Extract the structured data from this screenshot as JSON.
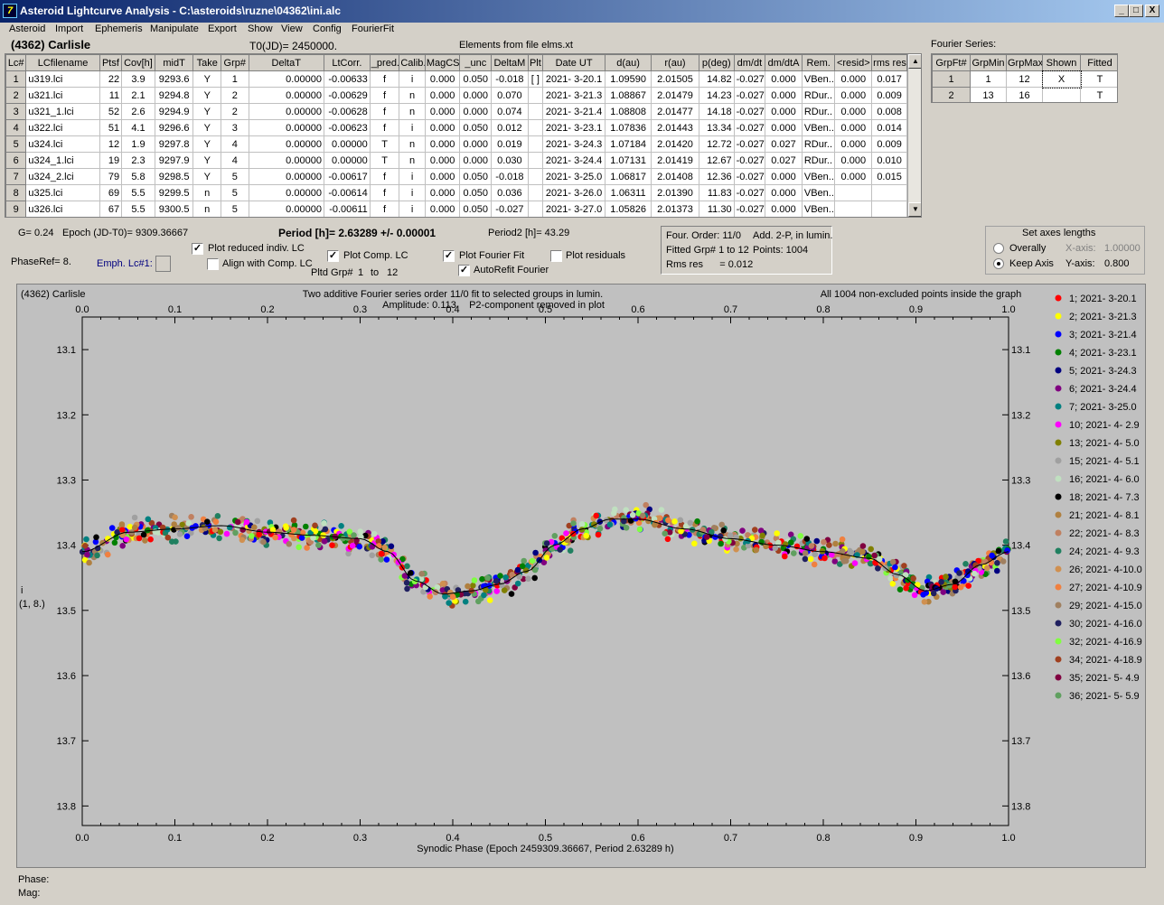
{
  "window": {
    "title": "Asteroid Lightcurve Analysis - C:\\asteroids\\ruzne\\04362\\ini.alc",
    "app_icon": "7",
    "min": "_",
    "max": "□",
    "close": "X"
  },
  "menu": [
    "Asteroid",
    "Import",
    "Ephemeris",
    "Manipulate",
    "Export",
    "Show",
    "View",
    "Config",
    "FourierFit"
  ],
  "header": {
    "object": "(4362) Carlisle",
    "t0": "T0(JD)= 2450000.",
    "elements": "Elements from file elms.xt",
    "fourier_series": "Fourier Series:"
  },
  "lc_table": {
    "columns": [
      "Lc#",
      "LCfilename",
      "Ptsf",
      "Cov[h]",
      "midT",
      "Take",
      "Grp#",
      "DeltaT",
      "LtCorr.",
      "_pred.",
      "Calib.",
      "MagCS",
      "_unc",
      "DeltaM",
      "Plt",
      "Date UT",
      "d(au)",
      "r(au)",
      "p(deg)",
      "dm/dt",
      "dm/dtA",
      "Rem.",
      "<resid>",
      "rms res"
    ],
    "rows": [
      [
        "1",
        "u319.lci",
        "22",
        "3.9",
        "9293.6",
        "Y",
        "1",
        "0.00000",
        "-0.00633",
        "f",
        "i",
        "0.000",
        "0.050",
        "-0.018",
        "[ ]",
        "2021- 3-20.1",
        "1.09590",
        "2.01505",
        "14.82",
        "-0.027",
        "0.000",
        "VBen..",
        "0.000",
        "0.017"
      ],
      [
        "2",
        "u321.lci",
        "11",
        "2.1",
        "9294.8",
        "Y",
        "2",
        "0.00000",
        "-0.00629",
        "f",
        "n",
        "0.000",
        "0.000",
        "0.070",
        "",
        "2021- 3-21.3",
        "1.08867",
        "2.01479",
        "14.23",
        "-0.027",
        "0.000",
        "RDur..",
        "0.000",
        "0.009"
      ],
      [
        "3",
        "u321_1.lci",
        "52",
        "2.6",
        "9294.9",
        "Y",
        "2",
        "0.00000",
        "-0.00628",
        "f",
        "n",
        "0.000",
        "0.000",
        "0.074",
        "",
        "2021- 3-21.4",
        "1.08808",
        "2.01477",
        "14.18",
        "-0.027",
        "0.000",
        "RDur..",
        "0.000",
        "0.008"
      ],
      [
        "4",
        "u322.lci",
        "51",
        "4.1",
        "9296.6",
        "Y",
        "3",
        "0.00000",
        "-0.00623",
        "f",
        "i",
        "0.000",
        "0.050",
        "0.012",
        "",
        "2021- 3-23.1",
        "1.07836",
        "2.01443",
        "13.34",
        "-0.027",
        "0.000",
        "VBen..",
        "0.000",
        "0.014"
      ],
      [
        "5",
        "u324.lci",
        "12",
        "1.9",
        "9297.8",
        "Y",
        "4",
        "0.00000",
        "0.00000",
        "T",
        "n",
        "0.000",
        "0.000",
        "0.019",
        "",
        "2021- 3-24.3",
        "1.07184",
        "2.01420",
        "12.72",
        "-0.027",
        "0.027",
        "RDur..",
        "0.000",
        "0.009"
      ],
      [
        "6",
        "u324_1.lci",
        "19",
        "2.3",
        "9297.9",
        "Y",
        "4",
        "0.00000",
        "0.00000",
        "T",
        "n",
        "0.000",
        "0.000",
        "0.030",
        "",
        "2021- 3-24.4",
        "1.07131",
        "2.01419",
        "12.67",
        "-0.027",
        "0.027",
        "RDur..",
        "0.000",
        "0.010"
      ],
      [
        "7",
        "u324_2.lci",
        "79",
        "5.8",
        "9298.5",
        "Y",
        "5",
        "0.00000",
        "-0.00617",
        "f",
        "i",
        "0.000",
        "0.050",
        "-0.018",
        "",
        "2021- 3-25.0",
        "1.06817",
        "2.01408",
        "12.36",
        "-0.027",
        "0.000",
        "VBen..",
        "0.000",
        "0.015"
      ],
      [
        "8",
        "u325.lci",
        "69",
        "5.5",
        "9299.5",
        "n",
        "5",
        "0.00000",
        "-0.00614",
        "f",
        "i",
        "0.000",
        "0.050",
        "0.036",
        "",
        "2021- 3-26.0",
        "1.06311",
        "2.01390",
        "11.83",
        "-0.027",
        "0.000",
        "VBen..",
        "",
        ""
      ],
      [
        "9",
        "u326.lci",
        "67",
        "5.5",
        "9300.5",
        "n",
        "5",
        "0.00000",
        "-0.00611",
        "f",
        "i",
        "0.000",
        "0.050",
        "-0.027",
        "",
        "2021- 3-27.0",
        "1.05826",
        "2.01373",
        "11.30",
        "-0.027",
        "0.000",
        "VBen..",
        "",
        ""
      ]
    ]
  },
  "fourier_table": {
    "columns": [
      "GrpFt#",
      "GrpMin",
      "GrpMax",
      "Shown",
      "Fitted"
    ],
    "rows": [
      [
        "1",
        "1",
        "12",
        "X",
        "T"
      ],
      [
        "2",
        "13",
        "16",
        "",
        "T"
      ]
    ]
  },
  "controls": {
    "g": "G= 0.24",
    "epoch": "Epoch (JD-T0)= 9309.36667",
    "period": "Period [h]= 2.63289 +/- 0.00001",
    "period2": "Period2 [h]= 43.29",
    "phaseref": "PhaseRef= 8.",
    "emph": "Emph. Lc#1:",
    "plot_reduced": "Plot reduced indiv. LC",
    "align": "Align with Comp. LC",
    "plot_comp": "Plot Comp. LC",
    "pltd_grp": "Pltd Grp#",
    "grp_from": "1",
    "to": "to",
    "grp_to": "12",
    "plot_fourier": "Plot Fourier Fit",
    "autorefit": "AutoRefit Fourier",
    "plot_resid": "Plot residuals",
    "check": "✓"
  },
  "fit_info": {
    "order": "Four. Order: 11/0",
    "add": "Add. 2-P, in lumin.",
    "fitted": "Fitted Grp# 1 to 12",
    "points": "Points: 1004",
    "rms": "Rms res      = 0.012"
  },
  "axes_box": {
    "title": "Set axes lengths",
    "overally": "Overally",
    "keep": "Keep Axis",
    "xaxis_label": "X-axis:",
    "xaxis_val": "1.00000",
    "yaxis_label": "Y-axis:",
    "yaxis_val": "0.800"
  },
  "plot": {
    "name": "(4362) Carlisle",
    "title1": "Two additive Fourier series order 11/0 fit to selected groups in lumin.",
    "title2": "Amplitude: 0.113",
    "title3": "P2-component removed in plot",
    "note": "All 1004 non-excluded points inside the graph",
    "ylabel1": "i",
    "ylabel2": "(1, 8.)",
    "xlabel": "Synodic Phase (Epoch 2459309.36667, Period 2.63289 h)"
  },
  "footer": {
    "phase": "Phase:",
    "mag": "Mag:"
  },
  "chart_data": {
    "type": "scatter",
    "xlim": [
      0,
      1
    ],
    "ylim": [
      13.83,
      13.05
    ],
    "y_inverted": true,
    "x_ticks": [
      "0.0",
      "0.1",
      "0.2",
      "0.3",
      "0.4",
      "0.5",
      "0.6",
      "0.7",
      "0.8",
      "0.9",
      "1.0"
    ],
    "y_ticks": [
      "13.1",
      "13.2",
      "13.3",
      "13.4",
      "13.5",
      "13.6",
      "13.7",
      "13.8"
    ],
    "fit_curve": {
      "x": [
        0.0,
        0.05,
        0.1,
        0.15,
        0.2,
        0.25,
        0.3,
        0.33,
        0.36,
        0.39,
        0.42,
        0.45,
        0.48,
        0.51,
        0.54,
        0.57,
        0.6,
        0.65,
        0.7,
        0.75,
        0.8,
        0.85,
        0.88,
        0.91,
        0.94,
        0.97,
        1.0
      ],
      "y": [
        13.41,
        13.38,
        13.375,
        13.37,
        13.38,
        13.385,
        13.39,
        13.41,
        13.455,
        13.475,
        13.47,
        13.46,
        13.44,
        13.4,
        13.375,
        13.36,
        13.36,
        13.375,
        13.39,
        13.4,
        13.41,
        13.42,
        13.445,
        13.47,
        13.46,
        13.43,
        13.41
      ]
    },
    "points": 1004,
    "legend": [
      {
        "label": "1; 2021- 3-20.1",
        "color": "#ff0000"
      },
      {
        "label": "2; 2021- 3-21.3",
        "color": "#ffff00"
      },
      {
        "label": "3; 2021- 3-21.4",
        "color": "#0000ff"
      },
      {
        "label": "4; 2021- 3-23.1",
        "color": "#008000"
      },
      {
        "label": "5; 2021- 3-24.3",
        "color": "#000080"
      },
      {
        "label": "6; 2021- 3-24.4",
        "color": "#800080"
      },
      {
        "label": "7; 2021- 3-25.0",
        "color": "#008080"
      },
      {
        "label": "10; 2021- 4- 2.9",
        "color": "#ff00ff"
      },
      {
        "label": "13; 2021- 4- 5.0",
        "color": "#808000"
      },
      {
        "label": "15; 2021- 4- 5.1",
        "color": "#a0a0a0"
      },
      {
        "label": "16; 2021- 4- 6.0",
        "color": "#c0e0c0"
      },
      {
        "label": "18; 2021- 4- 7.3",
        "color": "#000000"
      },
      {
        "label": "21; 2021- 4- 8.1",
        "color": "#b08040"
      },
      {
        "label": "22; 2021- 4- 8.3",
        "color": "#c08060"
      },
      {
        "label": "24; 2021- 4- 9.3",
        "color": "#208060"
      },
      {
        "label": "26; 2021- 4-10.0",
        "color": "#d09050"
      },
      {
        "label": "27; 2021- 4-10.9",
        "color": "#f08040"
      },
      {
        "label": "29; 2021- 4-15.0",
        "color": "#a08060"
      },
      {
        "label": "30; 2021- 4-16.0",
        "color": "#202060"
      },
      {
        "label": "32; 2021- 4-16.9",
        "color": "#80ff40"
      },
      {
        "label": "34; 2021- 4-18.9",
        "color": "#a04020"
      },
      {
        "label": "35; 2021- 5- 4.9",
        "color": "#800040"
      },
      {
        "label": "36; 2021- 5- 5.9",
        "color": "#60a060"
      }
    ]
  }
}
